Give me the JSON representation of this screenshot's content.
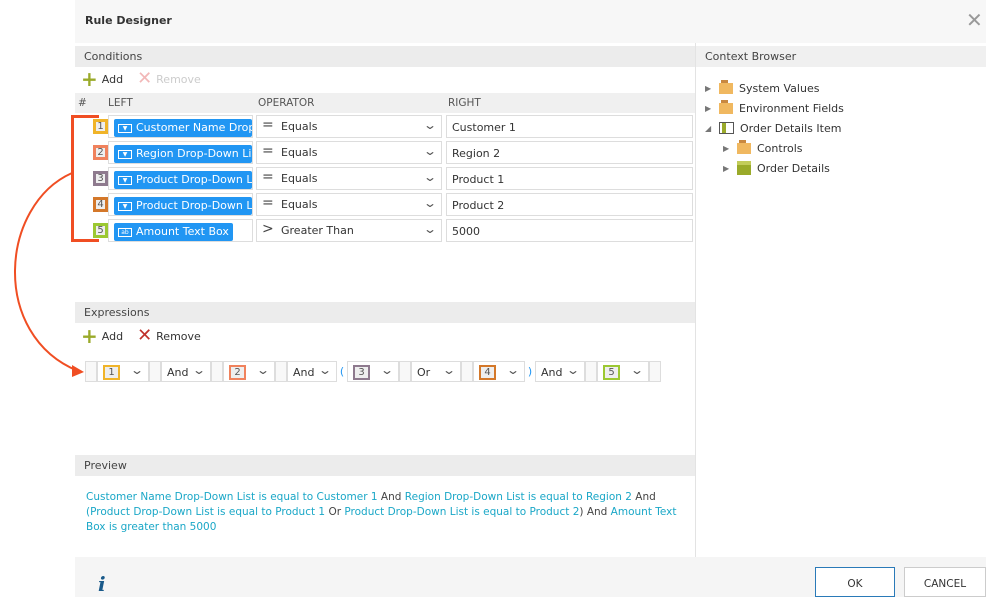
{
  "title": "Rule Designer",
  "conditions": {
    "header": "Conditions",
    "add": "Add",
    "remove": "Remove",
    "columns": {
      "num": "#",
      "left": "LEFT",
      "operator": "OPERATOR",
      "right": "RIGHT"
    },
    "rows": [
      {
        "n": "1",
        "left": "Customer Name Drop-Down List",
        "op": "Equals",
        "right": "Customer 1",
        "color": "#f0b429"
      },
      {
        "n": "2",
        "left": "Region Drop-Down List",
        "op": "Equals",
        "right": "Region 2",
        "color": "#f0825d"
      },
      {
        "n": "3",
        "left": "Product Drop-Down List",
        "op": "Equals",
        "right": "Product 1",
        "color": "#8e7a8e"
      },
      {
        "n": "4",
        "left": "Product Drop-Down List",
        "op": "Equals",
        "right": "Product 2",
        "color": "#d4782a"
      },
      {
        "n": "5",
        "left": "Amount Text Box",
        "op": "Greater Than",
        "right": "5000",
        "color": "#9cc832"
      }
    ]
  },
  "expressions": {
    "header": "Expressions",
    "add": "Add",
    "remove": "Remove",
    "items": [
      "1",
      "And",
      "2",
      "And",
      "(",
      "3",
      "Or",
      "4",
      ")",
      "And",
      "5"
    ]
  },
  "preview": {
    "header": "Preview",
    "parts": [
      {
        "t": "Customer Name Drop-Down List is equal to Customer 1",
        "c": true
      },
      {
        "t": " And ",
        "c": false
      },
      {
        "t": "Region Drop-Down List is equal to Region 2",
        "c": true
      },
      {
        "t": " And ",
        "c": false
      },
      {
        "t": "(",
        "c": true
      },
      {
        "t": "Product Drop-Down List is equal to Product 1",
        "c": true
      },
      {
        "t": " Or ",
        "c": false
      },
      {
        "t": "Product Drop-Down List is equal to Product 2",
        "c": true
      },
      {
        "t": ")",
        "c": false
      },
      {
        "t": " And ",
        "c": false
      },
      {
        "t": "Amount Text Box is greater than 5000",
        "c": true
      }
    ]
  },
  "context": {
    "header": "Context Browser",
    "items": [
      {
        "label": "System Values"
      },
      {
        "label": "Environment Fields"
      },
      {
        "label": "Order Details Item"
      },
      {
        "label": "Controls"
      },
      {
        "label": "Order Details"
      }
    ]
  },
  "footer": {
    "ok": "OK",
    "cancel": "CANCEL",
    "info": "i"
  }
}
